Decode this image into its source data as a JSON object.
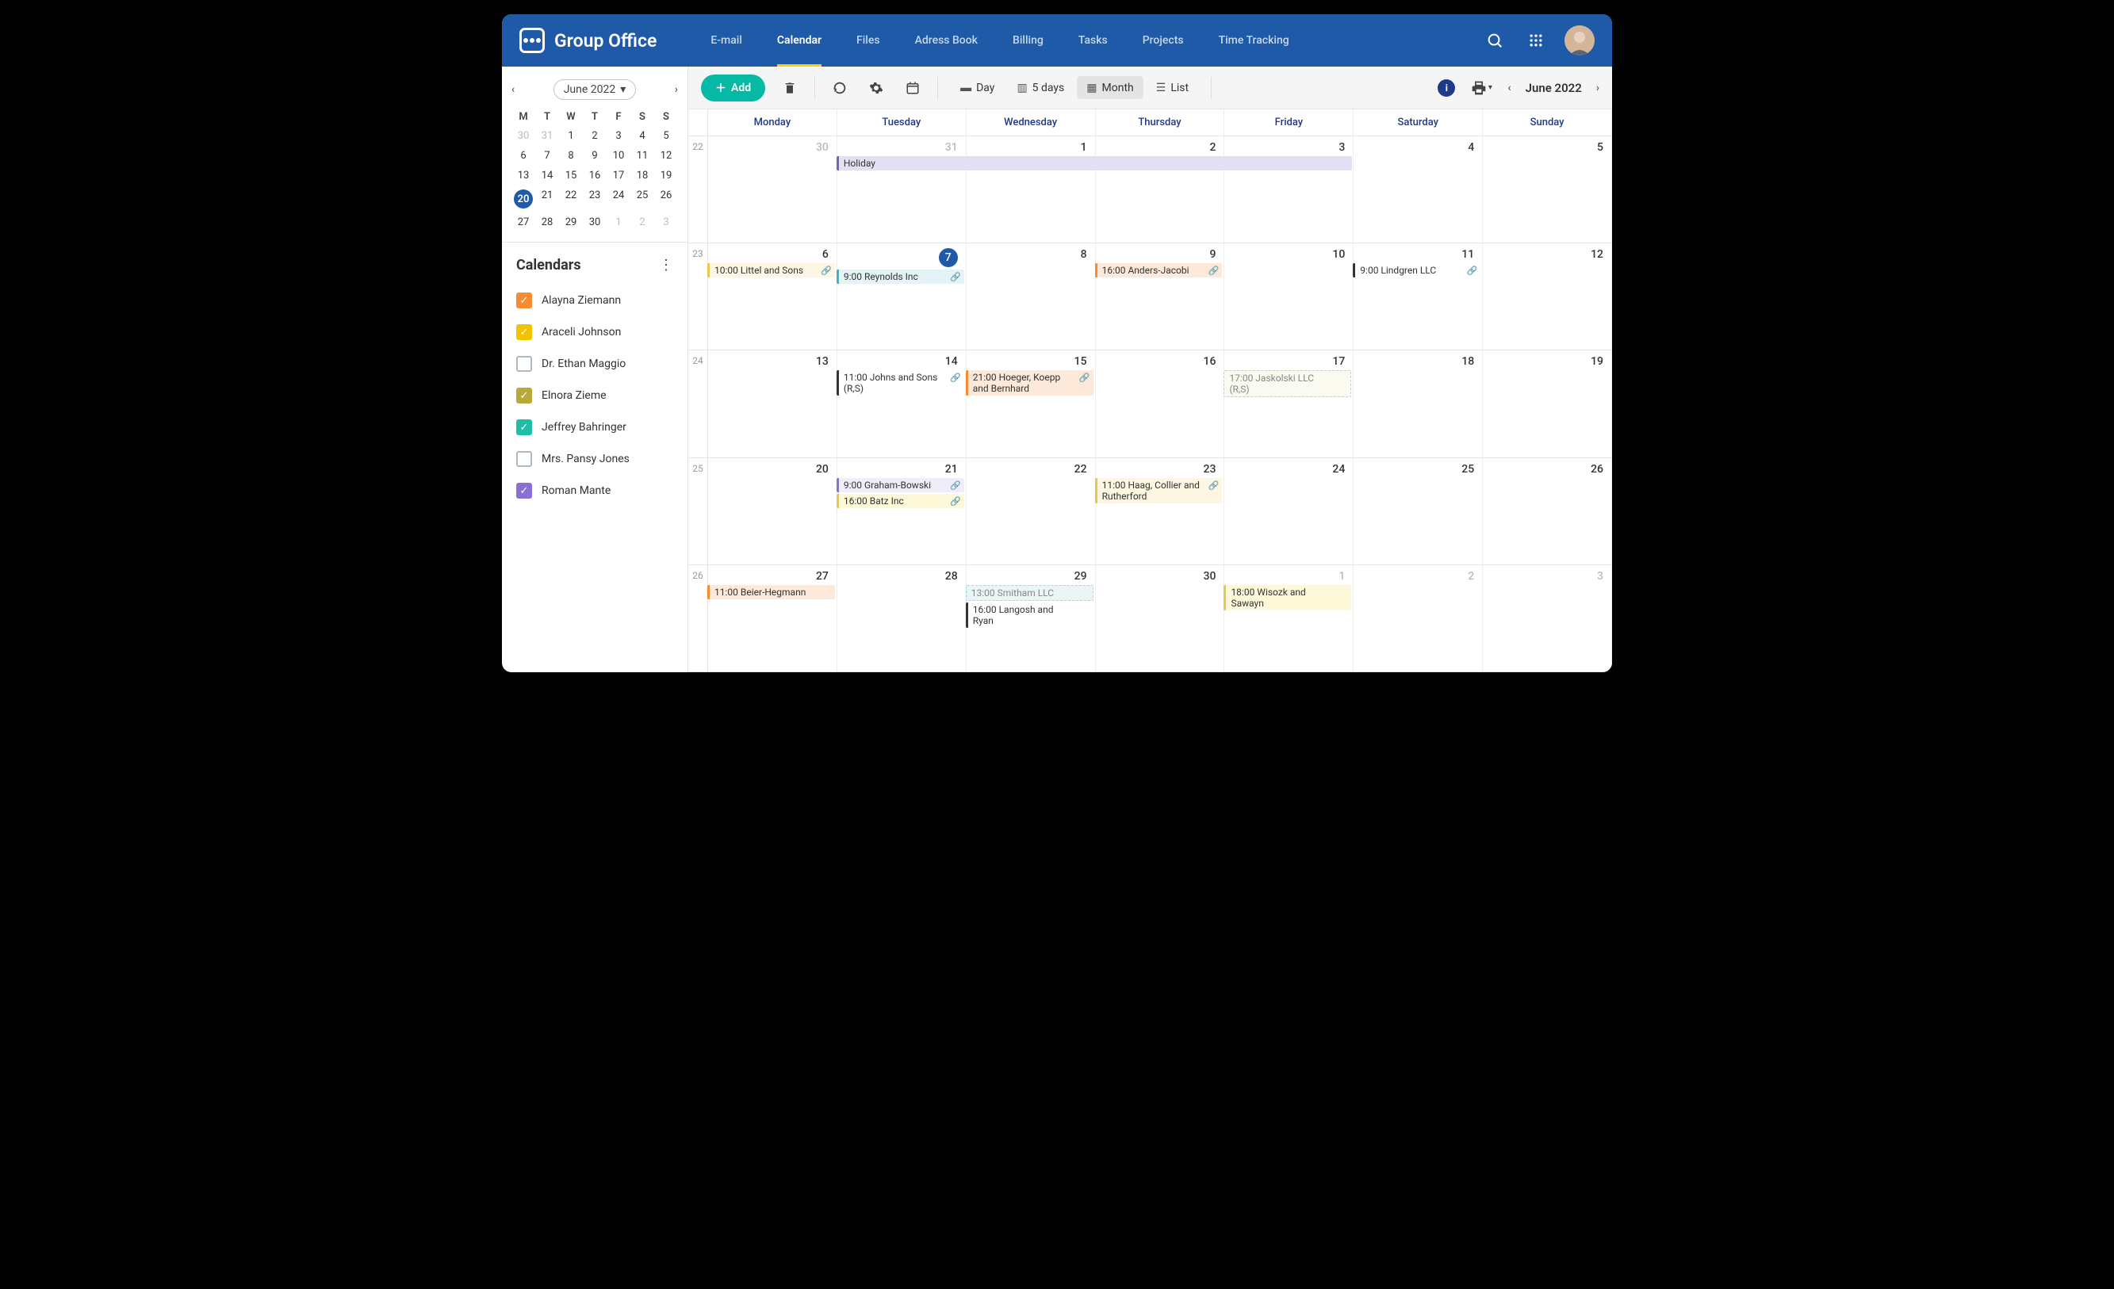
{
  "brand": "Group Office",
  "nav": [
    "E-mail",
    "Calendar",
    "Files",
    "Adress Book",
    "Billing",
    "Tasks",
    "Projects",
    "Time Tracking"
  ],
  "nav_active": 1,
  "mini": {
    "label": "June 2022",
    "dow": [
      "M",
      "T",
      "W",
      "T",
      "F",
      "S",
      "S"
    ],
    "rows": [
      [
        {
          "n": 30,
          "o": 1
        },
        {
          "n": 31,
          "o": 1
        },
        {
          "n": 1
        },
        {
          "n": 2
        },
        {
          "n": 3
        },
        {
          "n": 4
        },
        {
          "n": 5
        }
      ],
      [
        {
          "n": 6
        },
        {
          "n": 7
        },
        {
          "n": 8
        },
        {
          "n": 9
        },
        {
          "n": 10
        },
        {
          "n": 11
        },
        {
          "n": 12
        }
      ],
      [
        {
          "n": 13
        },
        {
          "n": 14
        },
        {
          "n": 15
        },
        {
          "n": 16
        },
        {
          "n": 17
        },
        {
          "n": 18
        },
        {
          "n": 19
        }
      ],
      [
        {
          "n": 20,
          "today": 1
        },
        {
          "n": 21
        },
        {
          "n": 22
        },
        {
          "n": 23
        },
        {
          "n": 24
        },
        {
          "n": 25
        },
        {
          "n": 26
        }
      ],
      [
        {
          "n": 27
        },
        {
          "n": 28
        },
        {
          "n": 29
        },
        {
          "n": 30
        },
        {
          "n": 1,
          "o": 1
        },
        {
          "n": 2,
          "o": 1
        },
        {
          "n": 3,
          "o": 1
        }
      ]
    ]
  },
  "calendars_title": "Calendars",
  "calendars": [
    {
      "name": "Alayna Ziemann",
      "color": "#f68b32",
      "checked": true
    },
    {
      "name": "Araceli Johnson",
      "color": "#f3c300",
      "checked": true
    },
    {
      "name": "Dr. Ethan Maggio",
      "color": "",
      "checked": false,
      "border": "#b0b8c0"
    },
    {
      "name": "Elnora Zieme",
      "color": "#b8a93a",
      "checked": true
    },
    {
      "name": "Jeffrey Bahringer",
      "color": "#1fbfa7",
      "checked": true
    },
    {
      "name": "Mrs. Pansy Jones",
      "color": "",
      "checked": false,
      "border": "#b0b8c0"
    },
    {
      "name": "Roman Mante",
      "color": "#8a6fd6",
      "checked": true
    }
  ],
  "toolbar": {
    "add": "Add",
    "views": [
      {
        "l": "Day"
      },
      {
        "l": "5 days"
      },
      {
        "l": "Month",
        "active": 1
      },
      {
        "l": "List"
      }
    ],
    "date": "June 2022"
  },
  "dow": [
    "Monday",
    "Tuesday",
    "Wednesday",
    "Thursday",
    "Friday",
    "Saturday",
    "Sunday"
  ],
  "weeks": [
    {
      "num": 22,
      "days": [
        {
          "n": 30,
          "o": 1
        },
        {
          "n": 31,
          "o": 1,
          "ev": [
            {
              "t": "Holiday",
              "bg": "#e2e1f2",
              "bc": "#6b64c9",
              "span": 4
            }
          ]
        },
        {
          "n": 1
        },
        {
          "n": 2
        },
        {
          "n": 3
        },
        {
          "n": 4
        },
        {
          "n": 5
        }
      ],
      "spanPad": [
        0,
        0,
        1,
        1,
        1,
        0,
        0
      ]
    },
    {
      "num": 23,
      "days": [
        {
          "n": 6,
          "ev": [
            {
              "t": "10:00 Littel and Sons",
              "bg": "#fdf6e3",
              "bc": "#e9c94c",
              "link": 1
            }
          ]
        },
        {
          "n": 7,
          "today": 1,
          "ev": [
            {
              "t": "9:00 Reynolds Inc",
              "bg": "#e4f3f5",
              "bc": "#36b5c9",
              "link": 1
            }
          ]
        },
        {
          "n": 8
        },
        {
          "n": 9,
          "ev": [
            {
              "t": "16:00 Anders-Jacobi",
              "bg": "#fce9d9",
              "bc": "#f68b32",
              "link": 1
            }
          ]
        },
        {
          "n": 10
        },
        {
          "n": 11,
          "ev": [
            {
              "t": "9:00 Lindgren LLC",
              "bg": "#fff",
              "bc": "#333",
              "link": 1
            }
          ]
        },
        {
          "n": 12
        }
      ]
    },
    {
      "num": 24,
      "days": [
        {
          "n": 13
        },
        {
          "n": 14,
          "ev": [
            {
              "t": "11:00 Johns and Sons (R,S)",
              "bg": "#fff",
              "bc": "#333",
              "link": 1
            }
          ]
        },
        {
          "n": 15,
          "ev": [
            {
              "t": "21:00 Hoeger, Koepp and Bernhard",
              "bg": "#fce9d9",
              "bc": "#f68b32",
              "link": 1
            }
          ]
        },
        {
          "n": 16
        },
        {
          "n": 17,
          "ev": [
            {
              "t": "17:00 Jaskolski LLC (R,S)",
              "bg": "#fafaf0",
              "bc": "#d2cf9e",
              "faded": 1
            }
          ]
        },
        {
          "n": 18
        },
        {
          "n": 19
        }
      ]
    },
    {
      "num": 25,
      "days": [
        {
          "n": 20
        },
        {
          "n": 21,
          "ev": [
            {
              "t": "9:00 Graham-Bowski",
              "bg": "#f0edfb",
              "bc": "#8a6fd6",
              "link": 1
            },
            {
              "t": "16:00 Batz Inc",
              "bg": "#fdf9d8",
              "bc": "#e9c94c",
              "link": 1
            }
          ]
        },
        {
          "n": 22
        },
        {
          "n": 23,
          "ev": [
            {
              "t": "11:00 Haag, Collier and Rutherford",
              "bg": "#fdf6e3",
              "bc": "#e9c94c",
              "link": 1
            }
          ]
        },
        {
          "n": 24
        },
        {
          "n": 25
        },
        {
          "n": 26
        }
      ]
    },
    {
      "num": 26,
      "days": [
        {
          "n": 27,
          "ev": [
            {
              "t": "11:00 Beier-Hegmann",
              "bg": "#fce9d9",
              "bc": "#f68b32"
            }
          ]
        },
        {
          "n": 28
        },
        {
          "n": 29,
          "ev": [
            {
              "t": "13:00 Smitham LLC",
              "bg": "#eaf5f6",
              "bc": "#8dd0d6",
              "faded": 1
            },
            {
              "t": "16:00 Langosh and Ryan",
              "bg": "#fff",
              "bc": "#333"
            }
          ]
        },
        {
          "n": 30
        },
        {
          "n": 1,
          "o": 1,
          "ev": [
            {
              "t": "18:00 Wisozk and Sawayn",
              "bg": "#fdf9d8",
              "bc": "#e9c94c"
            }
          ]
        },
        {
          "n": 2,
          "o": 1
        },
        {
          "n": 3,
          "o": 1
        }
      ]
    }
  ]
}
